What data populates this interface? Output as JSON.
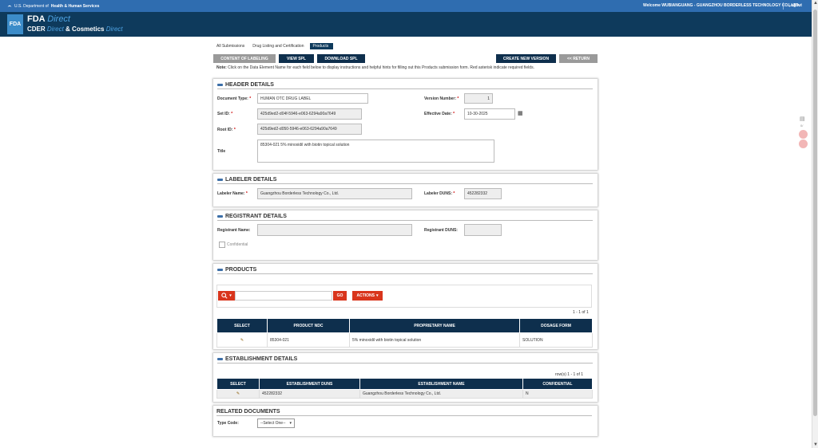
{
  "topbar": {
    "department": "U.S. Department of",
    "department_bold": "Health & Human Services",
    "welcome": "Welcome WUBIANGUANG - GUANGZHOU BORDERLESS TECHNOLOGY CO., LTD.",
    "logout": "Logout"
  },
  "brand": {
    "logo": "FDA",
    "line1": "FDA",
    "line1_italic": "Direct",
    "line2_a": "CDER",
    "line2_italic_a": "Direct",
    "line2_amp": "&",
    "line2_b": "Cosmetics",
    "line2_italic_b": "Direct"
  },
  "breadcrumb": [
    "All Submissions",
    "Drug Listing and Certification",
    "Products"
  ],
  "buttons": {
    "content_of_labeling": "CONTENT OF LABELING",
    "view_spl": "VIEW SPL",
    "download_spl": "DOWNLOAD SPL",
    "create_new_version": "CREATE NEW VERSION",
    "return": "<< RETURN"
  },
  "note": {
    "prefix": "Note:",
    "text": "Click on the Data Element Name for each field below to display instructions and helpful hints for filling out this Products submission form. Red asterisk indicate required fields."
  },
  "header_details": {
    "title": "HEADER DETAILS",
    "document_type_label": "Document Type:",
    "document_type": "HUMAN OTC DRUG LABEL",
    "version_number_label": "Version Number:",
    "version_number": "1",
    "set_id_label": "Set ID:",
    "set_id": "425d9ed2-d04f-5946-e063-6294a90a7649",
    "effective_date_label": "Effective Date:",
    "effective_date": "10-30-2025",
    "root_id_label": "Root ID:",
    "root_id": "425d9ed2-d050-5946-e063-6294a90a7649",
    "title_label": "Title",
    "title_value": "85304-021 5% minoxidil with biotin topical solution",
    "required_mark": "*"
  },
  "labeler_details": {
    "title": "LABELER DETAILS",
    "name_label": "Labeler Name:",
    "name": "Guangzhou Borderless Technology Co., Ltd.",
    "duns_label": "Labeler DUNS:",
    "duns": "452282332"
  },
  "registrant_details": {
    "title": "REGISTRANT DETAILS",
    "name_label": "Registrant Name:",
    "duns_label": "Registrant DUNS:",
    "confidential_label": "Confidential"
  },
  "products": {
    "title": "PRODUCTS",
    "go": "GO",
    "actions": "ACTIONS",
    "pager": "1 - 1 of 1",
    "columns": [
      "SELECT",
      "PRODUCT NDC",
      "PROPRIETARY NAME",
      "DOSAGE FORM"
    ],
    "rows": [
      {
        "ndc": "85304-021",
        "name": "5% minoxidil with biotin topical solution",
        "form": "SOLUTION"
      }
    ]
  },
  "establishment_details": {
    "title": "ESTABLISHMENT DETAILS",
    "pager": "row(s) 1 - 1 of 1",
    "columns": [
      "SELECT",
      "ESTABLISHMENT DUNS",
      "ESTABLISHMENT NAME",
      "CONFIDENTIAL"
    ],
    "rows": [
      {
        "duns": "452282332",
        "name": "Guangzhou Borderless Technology Co., Ltd.",
        "confidential": "N"
      }
    ]
  },
  "related_documents": {
    "title": "RELATED DOCUMENTS",
    "type_code_label": "Type Code:",
    "type_code_selected": "--Select One--"
  },
  "colors": {
    "topbar": "#2f6db0",
    "navy": "#0e3a5c",
    "accent_red": "#d9351c",
    "grey_button": "#9a9a9a"
  }
}
